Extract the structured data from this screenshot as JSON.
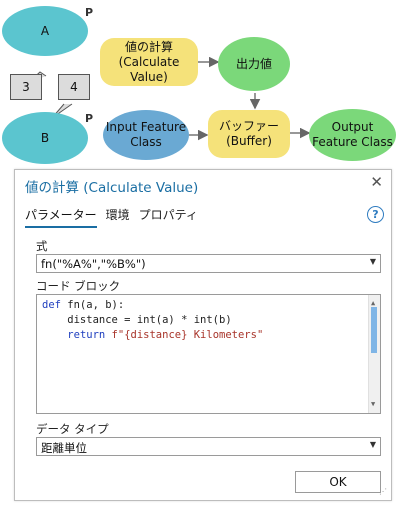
{
  "model": {
    "node_a": "A",
    "node_b": "B",
    "p_tag_a": "P",
    "p_tag_b": "P",
    "callout_3": "3",
    "callout_4": "4",
    "calc_value": "値の計算\n(Calculate Value)",
    "output_value": "出力値",
    "input_feature": "Input Feature\nClass",
    "buffer": "バッファー\n(Buffer)",
    "output_feature": "Output\nFeature Class",
    "colors": {
      "variable": "#5bc5cf",
      "input": "#6aa9d3",
      "tool": "#f5e27a",
      "output": "#7bd87a"
    }
  },
  "dialog": {
    "title": "値の計算 (Calculate Value)",
    "close_icon": "close-icon",
    "tabs": [
      "パラメーター",
      "環境",
      "プロパティ"
    ],
    "help_icon": "?",
    "expression_label": "式",
    "expression_value": "fn(\"%A%\",\"%B%\")",
    "code_block_label": "コード ブロック",
    "code": {
      "line1_kw": "def",
      "line1_rest": " fn(a, b):",
      "line2": "    distance = int(a) * int(b)",
      "line3_indent": "    ",
      "line3_kw": "return",
      "line3_str": " f\"{distance} Kilometers\""
    },
    "data_type_label": "データ タイプ",
    "data_type_value": "距離単位",
    "ok_label": "OK"
  }
}
